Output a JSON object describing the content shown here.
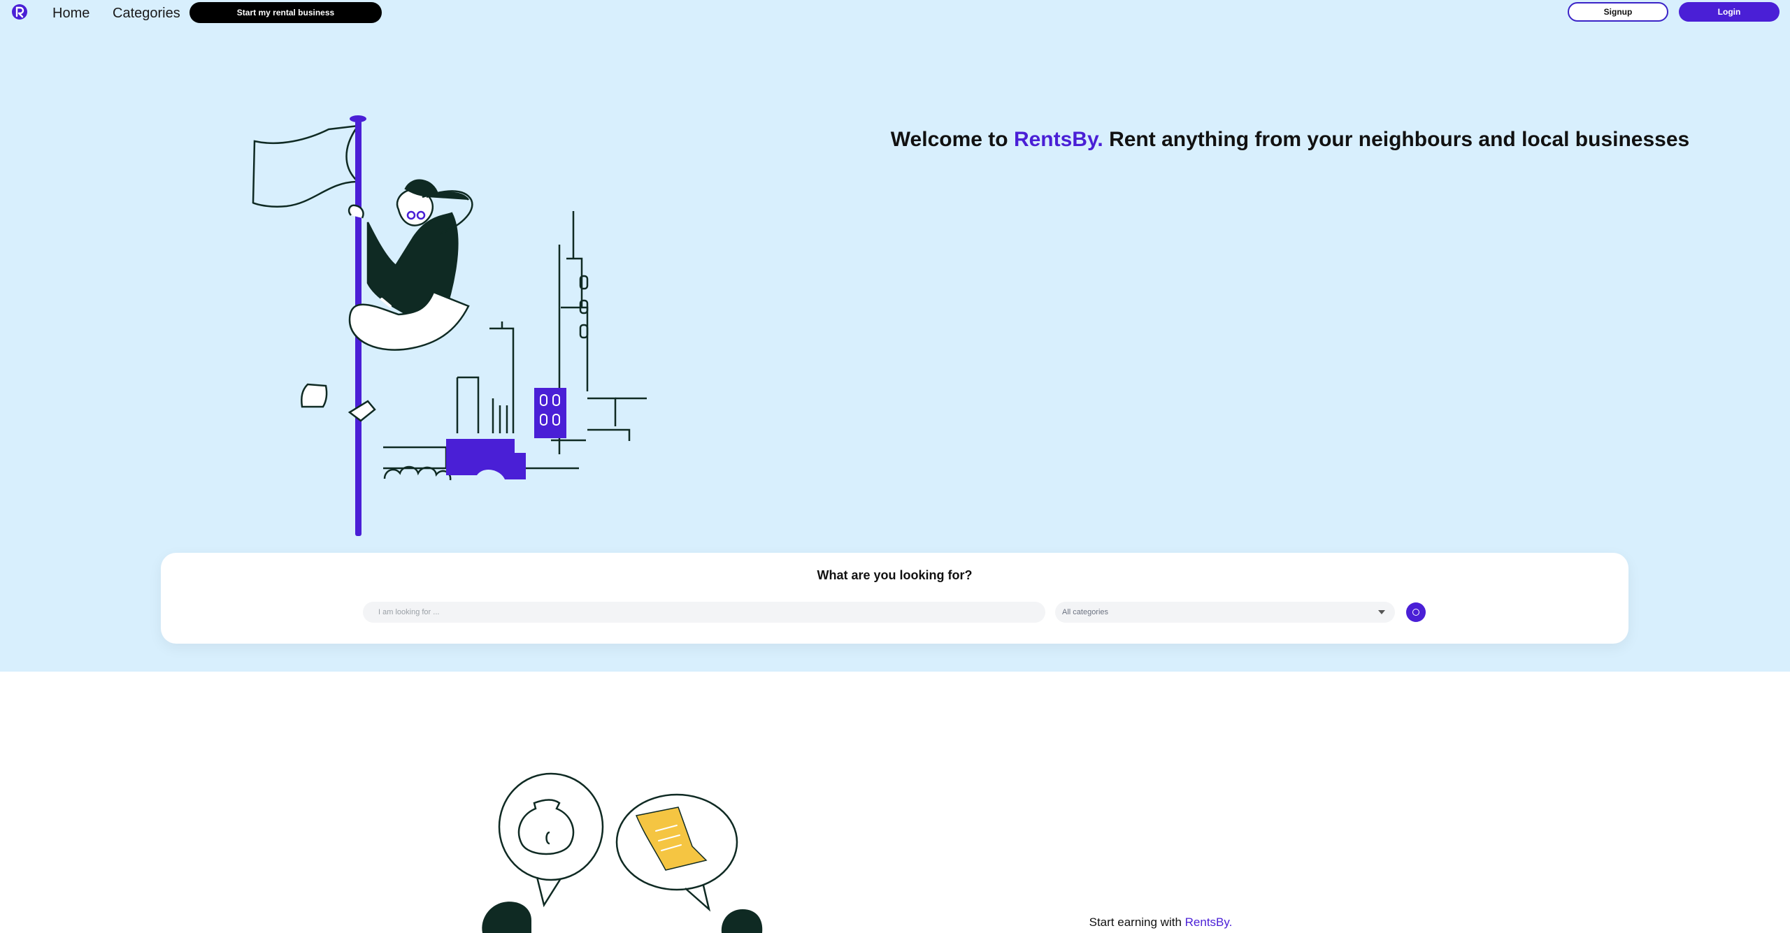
{
  "nav": {
    "home": "Home",
    "categories": "Categories",
    "start_business": "Start my rental business",
    "signup": "Signup",
    "login": "Login"
  },
  "hero": {
    "title_prefix": "Welcome to ",
    "brand": "RentsBy.",
    "title_suffix": " Rent anything from your neighbours and local businesses"
  },
  "search": {
    "heading": "What are you looking for?",
    "input_placeholder": "I am looking for ...",
    "category_selected": "All categories"
  },
  "earn": {
    "prefix": "Start earning with ",
    "brand": "RentsBy."
  },
  "colors": {
    "accent": "#4a1fd6",
    "hero_bg": "#d8effd",
    "illustration_dark": "#0f2a23",
    "illustration_yellow": "#f5c542"
  },
  "icons": {
    "logo": "rentsby-logo-icon",
    "search": "search-icon",
    "dropdown": "chevron-down-icon"
  }
}
